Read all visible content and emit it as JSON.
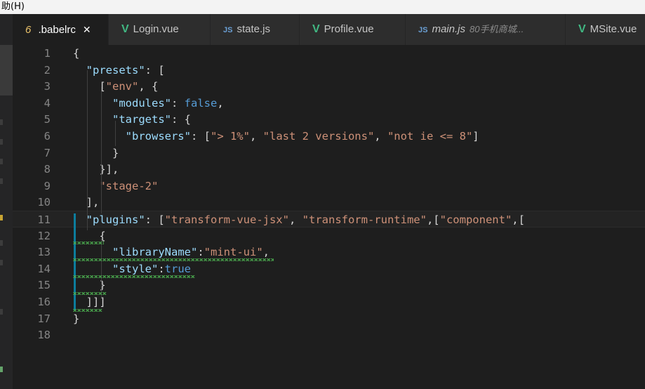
{
  "menubar": {
    "label": "助(H)"
  },
  "tabs": [
    {
      "icon": "6",
      "icon_type": "json",
      "label": "  .babelrc",
      "close": "✕",
      "active": true
    },
    {
      "icon": "V",
      "icon_type": "vue",
      "label": "Login.vue"
    },
    {
      "icon": "JS",
      "icon_type": "js",
      "label": "state.js"
    },
    {
      "icon": "V",
      "icon_type": "vue",
      "label": "Profile.vue"
    },
    {
      "icon": "JS",
      "icon_type": "js",
      "label": "main.js",
      "desc": "80手机商城..."
    },
    {
      "icon": "V",
      "icon_type": "vue",
      "label": "MSite.vue"
    }
  ],
  "editor": {
    "line_numbers": [
      "1",
      "2",
      "3",
      "4",
      "5",
      "6",
      "7",
      "8",
      "9",
      "10",
      "11",
      "12",
      "13",
      "14",
      "15",
      "16",
      "17",
      "18"
    ],
    "lines": [
      [
        [
          "p",
          "{"
        ]
      ],
      [
        [
          "p",
          "  "
        ],
        [
          "k",
          "\"presets\""
        ],
        [
          "p",
          ": ["
        ]
      ],
      [
        [
          "p",
          "    ["
        ],
        [
          "s",
          "\"env\""
        ],
        [
          "p",
          ", {"
        ]
      ],
      [
        [
          "p",
          "      "
        ],
        [
          "k",
          "\"modules\""
        ],
        [
          "p",
          ": "
        ],
        [
          "b",
          "false"
        ],
        [
          "p",
          ","
        ]
      ],
      [
        [
          "p",
          "      "
        ],
        [
          "k",
          "\"targets\""
        ],
        [
          "p",
          ": {"
        ]
      ],
      [
        [
          "p",
          "        "
        ],
        [
          "k",
          "\"browsers\""
        ],
        [
          "p",
          ": ["
        ],
        [
          "s",
          "\"> 1%\""
        ],
        [
          "p",
          ", "
        ],
        [
          "s",
          "\"last 2 versions\""
        ],
        [
          "p",
          ", "
        ],
        [
          "s",
          "\"not ie <= 8\""
        ],
        [
          "p",
          "]"
        ]
      ],
      [
        [
          "p",
          "      }"
        ]
      ],
      [
        [
          "p",
          "    }],"
        ]
      ],
      [
        [
          "p",
          "    "
        ],
        [
          "s",
          "\"stage-2\""
        ]
      ],
      [
        [
          "p",
          "  ],"
        ]
      ],
      [
        [
          "p",
          "  "
        ],
        [
          "k",
          "\"plugins\""
        ],
        [
          "p",
          ": ["
        ],
        [
          "s",
          "\"transform-vue-jsx\""
        ],
        [
          "p",
          ", "
        ],
        [
          "s",
          "\"transform-runtime\""
        ],
        [
          "p",
          ",["
        ],
        [
          "s",
          "\"component\""
        ],
        [
          "p",
          ",["
        ]
      ],
      [
        [
          "p",
          "    {"
        ]
      ],
      [
        [
          "p",
          "      "
        ],
        [
          "k",
          "\"libraryName\""
        ],
        [
          "p",
          ":"
        ],
        [
          "s",
          "\"mint-ui\""
        ],
        [
          "p",
          ","
        ]
      ],
      [
        [
          "p",
          "      "
        ],
        [
          "k",
          "\"style\""
        ],
        [
          "p",
          ":"
        ],
        [
          "b",
          "true"
        ]
      ],
      [
        [
          "p",
          "    }"
        ]
      ],
      [
        [
          "p",
          "  ]]]"
        ]
      ],
      [
        [
          "p",
          "}"
        ]
      ],
      [
        [
          "p",
          ""
        ]
      ]
    ]
  }
}
